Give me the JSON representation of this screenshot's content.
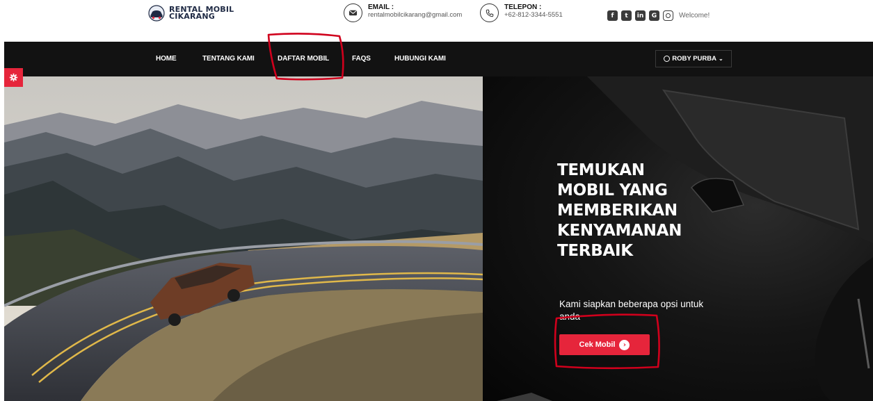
{
  "brand": {
    "line1": "RENTAL MOBIL",
    "line2": "CIKARANG"
  },
  "contact": {
    "email_label": "EMAIL :",
    "email_value": "rentalmobilcikarang@gmail.com",
    "phone_label": "TELEPON :",
    "phone_value": "+62-812-3344-5551"
  },
  "social": {
    "icons": [
      "facebook-icon",
      "twitter-icon",
      "linkedin-icon",
      "google-plus-icon",
      "instagram-icon"
    ],
    "welcome": "Welcome!"
  },
  "nav": {
    "items": [
      "HOME",
      "TENTANG KAMI",
      "DAFTAR MOBIL",
      "FAQS",
      "HUBUNGI KAMI"
    ],
    "user": "ROBY PURBA"
  },
  "hero": {
    "title_lines": [
      "TEMUKAN",
      "MOBIL YANG",
      "MEMBERIKAN",
      "KENYAMANAN",
      "TERBAIK"
    ],
    "subtitle": "Kami siapkan beberapa opsi untuk anda",
    "cta": "Cek Mobil"
  },
  "colors": {
    "accent": "#e6253b",
    "nav_bg": "#121212",
    "annotation": "#d0001c"
  }
}
